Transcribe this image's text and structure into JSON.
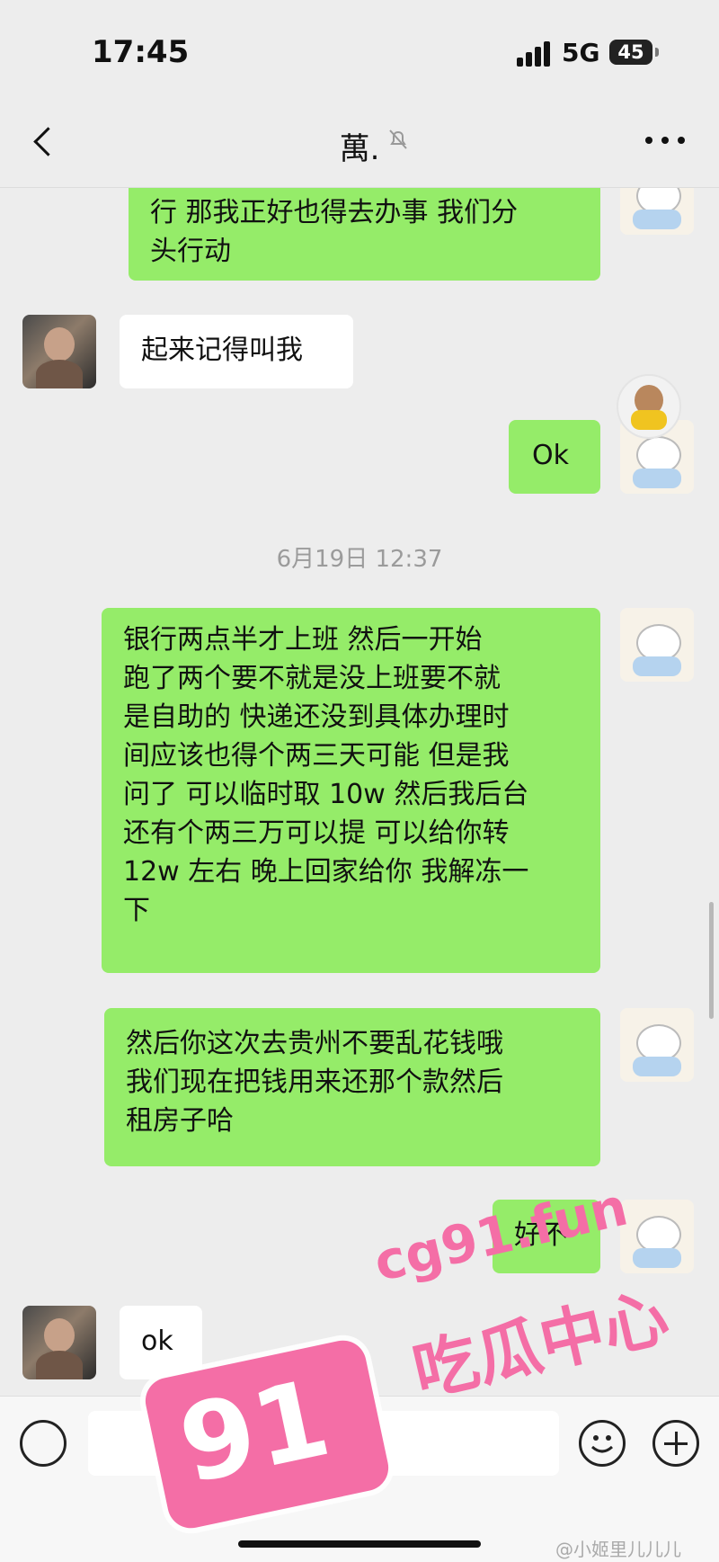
{
  "status": {
    "time": "17:45",
    "network": "5G",
    "battery": "45"
  },
  "header": {
    "title": "萬."
  },
  "messages": [
    {
      "side": "sent",
      "text": "行 那我正好也得去办事 我们分\n头行动"
    },
    {
      "side": "recv",
      "text": "起来记得叫我"
    },
    {
      "side": "sent",
      "text": "Ok"
    },
    {
      "type": "time",
      "text": "6月19日 12:37"
    },
    {
      "side": "sent",
      "text": "银行两点半才上班 然后一开始\n跑了两个要不就是没上班要不就\n是自助的 快递还没到具体办理时\n间应该也得个两三天可能 但是我\n问了 可以临时取 10w 然后我后台\n还有个两三万可以提 可以给你转\n12w 左右 晚上回家给你 我解冻一\n下"
    },
    {
      "side": "sent",
      "text": "然后你这次去贵州不要乱花钱哦\n我们现在把钱用来还那个款然后\n租房子哈"
    },
    {
      "side": "sent",
      "text": "好不"
    },
    {
      "side": "recv",
      "text": "ok"
    }
  ],
  "watermark": {
    "url": "cg91.fun",
    "brand": "吃瓜中心",
    "number": "91"
  },
  "credit": "@小姬里儿儿儿"
}
